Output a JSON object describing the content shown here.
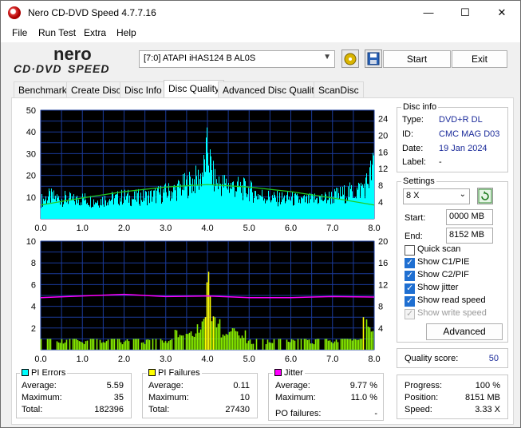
{
  "window": {
    "title": "Nero CD-DVD Speed 4.7.7.16",
    "min": "—",
    "max": "☐",
    "close": "✕"
  },
  "menu": [
    "File",
    "Run Test",
    "Extra",
    "Help"
  ],
  "drive": {
    "value": "[7:0]   ATAPI iHAS124   B AL0S"
  },
  "buttons": {
    "start": "Start",
    "exit": "Exit",
    "advanced": "Advanced"
  },
  "tabs": [
    "Benchmark",
    "Create Disc",
    "Disc Info",
    "Disc Quality",
    "Advanced Disc Quality",
    "ScanDisc"
  ],
  "disc_info": {
    "title": "Disc info",
    "type_label": "Type:",
    "type": "DVD+R DL",
    "id_label": "ID:",
    "id": "CMC MAG D03",
    "date_label": "Date:",
    "date": "19 Jan 2024",
    "label_label": "Label:",
    "label": "-"
  },
  "settings": {
    "title": "Settings",
    "speed": "8 X",
    "start_label": "Start:",
    "start": "0000 MB",
    "end_label": "End:",
    "end": "8152 MB",
    "checks": [
      {
        "label": "Quick scan",
        "state": "unchecked"
      },
      {
        "label": "Show C1/PIE",
        "state": "checked"
      },
      {
        "label": "Show C2/PIF",
        "state": "checked"
      },
      {
        "label": "Show jitter",
        "state": "checked"
      },
      {
        "label": "Show read speed",
        "state": "checked"
      },
      {
        "label": "Show write speed",
        "state": "disabled"
      }
    ]
  },
  "quality": {
    "label": "Quality score:",
    "value": "50"
  },
  "progress": {
    "progress_label": "Progress:",
    "progress": "100 %",
    "position_label": "Position:",
    "position": "8151 MB",
    "speed_label": "Speed:",
    "speed": "3.33 X"
  },
  "pi_errors": {
    "title": "PI Errors",
    "color": "#00ffff",
    "avg_label": "Average:",
    "avg": "5.59",
    "max_label": "Maximum:",
    "max": "35",
    "total_label": "Total:",
    "total": "182396"
  },
  "pi_failures": {
    "title": "PI Failures",
    "color": "#ffff00",
    "avg_label": "Average:",
    "avg": "0.11",
    "max_label": "Maximum:",
    "max": "10",
    "total_label": "Total:",
    "total": "27430"
  },
  "jitter": {
    "title": "Jitter",
    "color": "#ff00ff",
    "avg_label": "Average:",
    "avg": "9.77 %",
    "max_label": "Maximum:",
    "max": "11.0 %",
    "po_label": "PO failures:",
    "po": "-"
  },
  "chart_data": [
    {
      "type": "area",
      "x_ticks": [
        "0.0",
        "1.0",
        "2.0",
        "3.0",
        "4.0",
        "5.0",
        "6.0",
        "7.0",
        "8.0"
      ],
      "y_left_ticks": [
        "50",
        "40",
        "30",
        "20",
        "10"
      ],
      "y_right_ticks": [
        "24",
        "20",
        "16",
        "12",
        "8",
        "4"
      ],
      "xlim": [
        0,
        8
      ],
      "ylim": [
        0,
        50
      ],
      "y2lim": [
        0,
        26
      ],
      "series": [
        {
          "name": "PI Errors",
          "color": "#00ffff",
          "x": [
            0,
            0.2,
            0.4,
            0.6,
            0.8,
            1.0,
            1.2,
            1.4,
            1.6,
            1.8,
            2.0,
            2.2,
            2.4,
            2.6,
            2.8,
            3.0,
            3.2,
            3.4,
            3.6,
            3.8,
            3.9,
            4.0,
            4.1,
            4.2,
            4.4,
            4.6,
            4.8,
            5.0,
            5.2,
            5.4,
            5.6,
            5.8,
            6.0,
            6.2,
            6.4,
            6.6,
            6.8,
            7.0,
            7.2,
            7.4,
            7.6,
            7.8,
            8.0
          ],
          "y": [
            9,
            11,
            10,
            10,
            9,
            10,
            9,
            9,
            10,
            10,
            11,
            10,
            11,
            11,
            12,
            13,
            14,
            16,
            18,
            20,
            24,
            35,
            22,
            18,
            17,
            16,
            15,
            14,
            12,
            11,
            10,
            10,
            10,
            9,
            9,
            10,
            10,
            11,
            12,
            13,
            14,
            17,
            27
          ]
        },
        {
          "name": "Read Speed",
          "color": "#22cc22",
          "x": [
            0,
            1,
            2,
            3,
            4,
            5,
            6,
            7,
            8
          ],
          "y": [
            3.3,
            5.0,
            6.5,
            7.6,
            8.2,
            7.6,
            6.5,
            5.0,
            3.3
          ]
        }
      ]
    },
    {
      "type": "bar",
      "x_ticks": [
        "0.0",
        "1.0",
        "2.0",
        "3.0",
        "4.0",
        "5.0",
        "6.0",
        "7.0",
        "8.0"
      ],
      "y_left_ticks": [
        "10",
        "8",
        "6",
        "4",
        "2"
      ],
      "y_right_ticks": [
        "20",
        "16",
        "12",
        "8",
        "4"
      ],
      "xlim": [
        0,
        8
      ],
      "ylim": [
        0,
        10
      ],
      "y2lim": [
        0,
        20
      ],
      "series": [
        {
          "name": "PI Failures",
          "color": "#ffff00",
          "x": [
            0.5,
            1.0,
            1.5,
            2.0,
            2.5,
            3.0,
            3.3,
            3.6,
            3.8,
            3.9,
            3.95,
            4.0,
            4.05,
            4.1,
            4.2,
            4.4,
            4.6,
            4.8,
            5.0,
            5.5,
            6.0,
            6.5,
            7.0,
            7.5,
            7.9
          ],
          "y": [
            1,
            1,
            1,
            1,
            1,
            1,
            2,
            2,
            3,
            4,
            6,
            10,
            7,
            5,
            3,
            2,
            2,
            2,
            1,
            1,
            1,
            1,
            1,
            1,
            3
          ]
        },
        {
          "name": "Jitter",
          "color": "#ff00ff",
          "x": [
            0,
            1,
            2,
            3,
            4,
            5,
            6,
            7,
            8
          ],
          "y": [
            9.6,
            9.9,
            10.2,
            9.8,
            9.9,
            9.6,
            9.6,
            9.8,
            9.7
          ]
        }
      ]
    }
  ]
}
